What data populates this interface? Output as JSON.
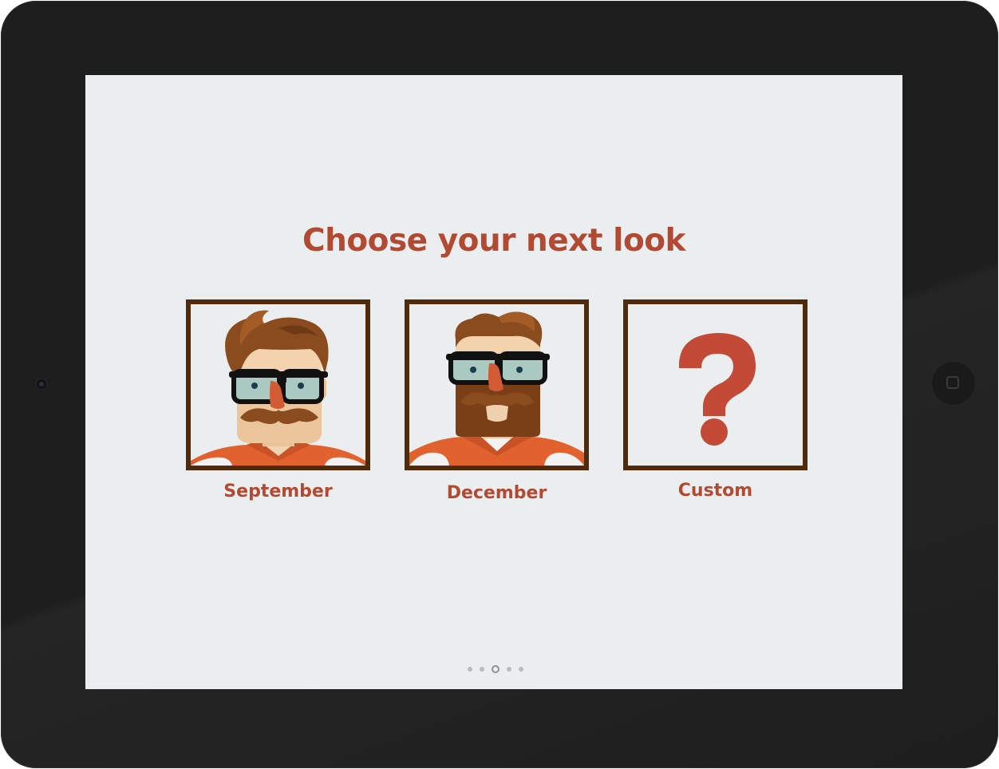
{
  "screen": {
    "title": "Choose your next look",
    "background": "#ebeeef",
    "accent": "#b24a33",
    "frame_color": "#4f2a0c"
  },
  "options": [
    {
      "label": "September",
      "image": "hipster-avatar-glasses-mustache"
    },
    {
      "label": "December",
      "image": "hipster-avatar-glasses-beard"
    },
    {
      "label": "Custom",
      "image": "question-mark-icon"
    }
  ],
  "pager": {
    "page_count": 5,
    "active_page": 3
  }
}
